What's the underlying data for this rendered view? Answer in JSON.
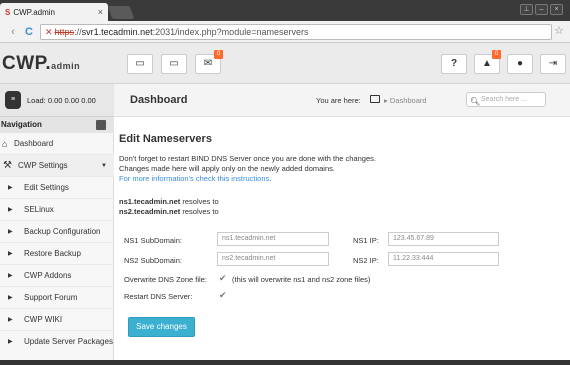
{
  "browser": {
    "tab_favicon": "S",
    "tab_title": "CWP.admin",
    "tab_close": "×",
    "back_icon": "‹",
    "forward_icon": "›",
    "reload_icon": "C",
    "url_scheme": "https",
    "url_sep": "://",
    "url_host": "svr1.tecadmin.net",
    "url_rest": ":2031/index.php?module=nameservers",
    "star_icon": "☆"
  },
  "header": {
    "logo": "CWP.",
    "logo_suffix": "admin",
    "badges": {
      "mail": "0",
      "bell": "0"
    },
    "help_label": "?"
  },
  "sidebar": {
    "load_label": "Load: 0.00  0.00  0.00",
    "nav_header": "Navigation",
    "dashboard": "Dashboard",
    "settings": "CWP Settings",
    "items": [
      "Edit Settings",
      "SELinux",
      "Backup Configuration",
      "Restore Backup",
      "CWP Addons",
      "Support Forum",
      "CWP WIKI",
      "Update Server Packages"
    ]
  },
  "topbar": {
    "title": "Dashboard",
    "you_are_here": "You are here:",
    "crumb": "Dashboard",
    "search_placeholder": "Search here ..."
  },
  "content": {
    "title": "Edit Nameservers",
    "line1": "Don't forget to restart BIND DNS Server once you are done with the changes.",
    "line2": "Changes made here will apply only on the newly added domains.",
    "line3": "For more information's check this instructions.",
    "ns1_host": "ns1.tecadmin.net",
    "ns1_resolves": " resolves to",
    "ns2_host": "ns2.tecadmin.net",
    "ns2_resolves": " resolves to",
    "ns1_sub_label": "NS1 SubDomain:",
    "ns1_sub_value": "ns1.tecadmin.net",
    "ns1_ip_label": "NS1 IP:",
    "ns1_ip_value": "123.45.67.89",
    "ns2_sub_label": "NS2 SubDomain:",
    "ns2_sub_value": "ns2.tecadmin.net",
    "ns2_ip_label": "NS2 IP:",
    "ns2_ip_value": "11.22.33.444",
    "overwrite_label": "Overwrite DNS Zone file:",
    "overwrite_note": "(this will overwrite ns1 and ns2 zone files)",
    "restart_label": "Restart DNS Server:",
    "save_label": "Save changes"
  }
}
